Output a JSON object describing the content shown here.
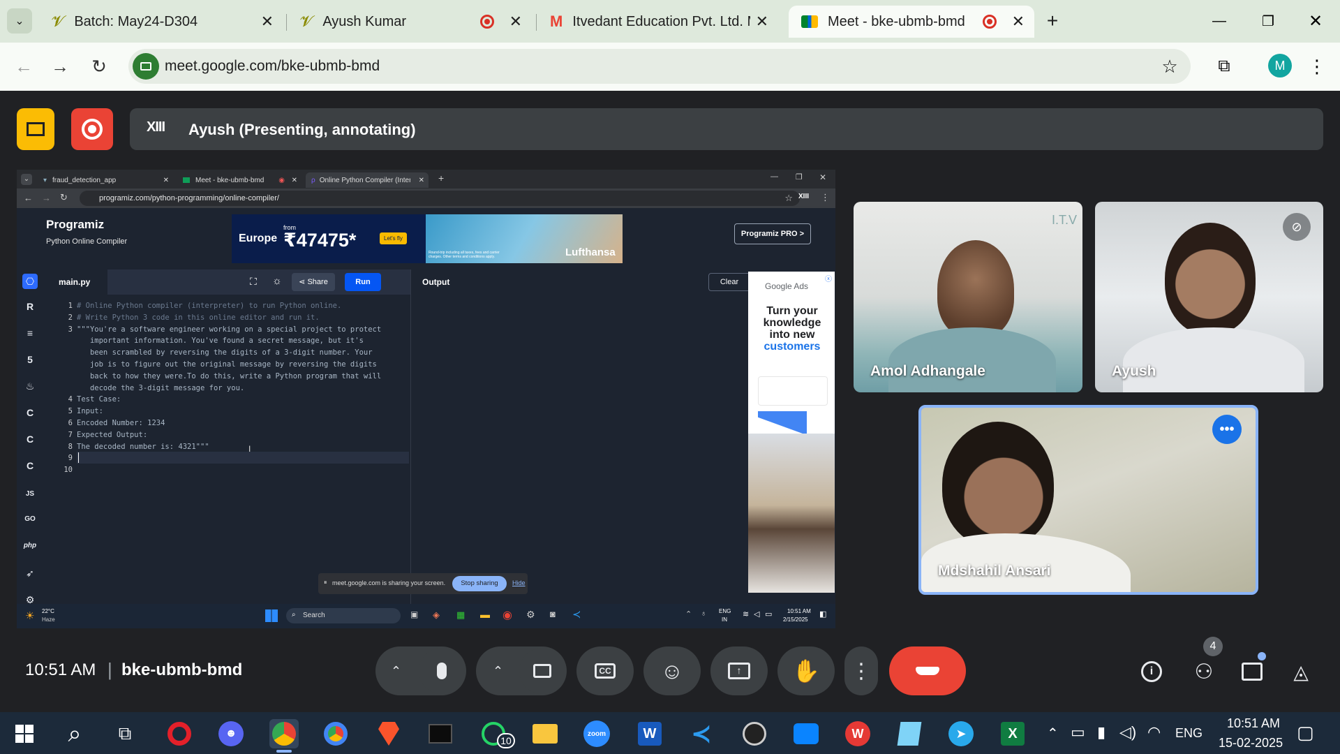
{
  "browser": {
    "tabs": [
      {
        "title": "Batch: May24-D304",
        "close": "✕"
      },
      {
        "title": "Ayush Kumar",
        "close": "✕"
      },
      {
        "title": "Itvedant Education Pvt. Ltd. Ma",
        "close": "✕"
      },
      {
        "title": "Meet - bke-ubmb-bmd",
        "close": "✕"
      }
    ],
    "new_tab": "+",
    "url": "meet.google.com/bke-ubmb-bmd",
    "profile_initial": "M",
    "window_controls": {
      "minimize": "—",
      "restore": "❐",
      "close": "✕"
    }
  },
  "meet": {
    "presenter_banner": "Ayush (Presenting, annotating)",
    "presenter_avatar": "XIII",
    "time": "10:51 AM",
    "divider": "|",
    "meeting_code": "bke-ubmb-bmd",
    "participants_count": "4",
    "participants": [
      {
        "name": "Amol Adhangale"
      },
      {
        "name": "Ayush"
      },
      {
        "name": "Mdshahil Ansari"
      }
    ],
    "tile_logo": "I.T.V"
  },
  "shared_screen": {
    "tabs": [
      {
        "title": "fraud_detection_app"
      },
      {
        "title": "Meet - bke-ubmb-bmd"
      },
      {
        "title": "Online Python Compiler (Interp"
      }
    ],
    "url": "programiz.com/python-programming/online-compiler/",
    "brand": "Programiz",
    "brand_sub": "Python Online Compiler",
    "ad": {
      "region": "Europe",
      "from": "from",
      "price": "₹47475*",
      "cta": "Let's fly",
      "airline": "Lufthansa",
      "fine_print": "Round-trip including all taxes, fees and carrier charges. Other terms and conditions apply."
    },
    "pro_button": "Programiz PRO >",
    "file_tab": "main.py",
    "share_label": "Share",
    "run_label": "Run",
    "output_label": "Output",
    "clear_label": "Clear",
    "side_ad": {
      "brand": "Google Ads",
      "headline": "Turn your knowledge into new",
      "accent": "customers"
    },
    "code_lines": [
      {
        "n": "1",
        "text": "# Online Python compiler (interpreter) to run Python online."
      },
      {
        "n": "2",
        "text": "# Write Python 3 code in this online editor and run it."
      },
      {
        "n": "3",
        "text": "\"\"\"You're a software engineer working on a special project to protect"
      },
      {
        "n": "",
        "text": "   important information. You've found a secret message, but it's"
      },
      {
        "n": "",
        "text": "   been scrambled by reversing the digits of a 3-digit number. Your"
      },
      {
        "n": "",
        "text": "   job is to figure out the original message by reversing the digits"
      },
      {
        "n": "",
        "text": "   back to how they were.To do this, write a Python program that will"
      },
      {
        "n": "",
        "text": "   decode the 3-digit message for you."
      },
      {
        "n": "4",
        "text": "Test Case:"
      },
      {
        "n": "5",
        "text": "Input:"
      },
      {
        "n": "6",
        "text": "Encoded Number: 1234"
      },
      {
        "n": "7",
        "text": "Expected Output:"
      },
      {
        "n": "8",
        "text": "The decoded number is: 4321\"\"\""
      },
      {
        "n": "9",
        "text": ""
      },
      {
        "n": "10",
        "text": ""
      }
    ],
    "sharing_notice": "meet.google.com is sharing your screen.",
    "stop_sharing": "Stop sharing",
    "hide": "Hide",
    "side_icons": [
      "JS",
      "GO",
      "php"
    ],
    "taskbar": {
      "weather_temp": "22°C",
      "weather_desc": "Haze",
      "search": "Search",
      "lang": "ENG",
      "lang_sub": "IN",
      "time": "10:51 AM",
      "date": "2/15/2025"
    }
  },
  "taskbar": {
    "whatsapp_badge": "10",
    "zoom_label": "zoom",
    "lang": "ENG",
    "time": "10:51 AM",
    "date": "15-02-2025"
  },
  "colors": {
    "meet_bg": "#202124",
    "end_call": "#ea4335",
    "record": "#ea4335",
    "present": "#fbbc04",
    "active_tile": "#8ab4f8",
    "run": "#0556f3"
  }
}
